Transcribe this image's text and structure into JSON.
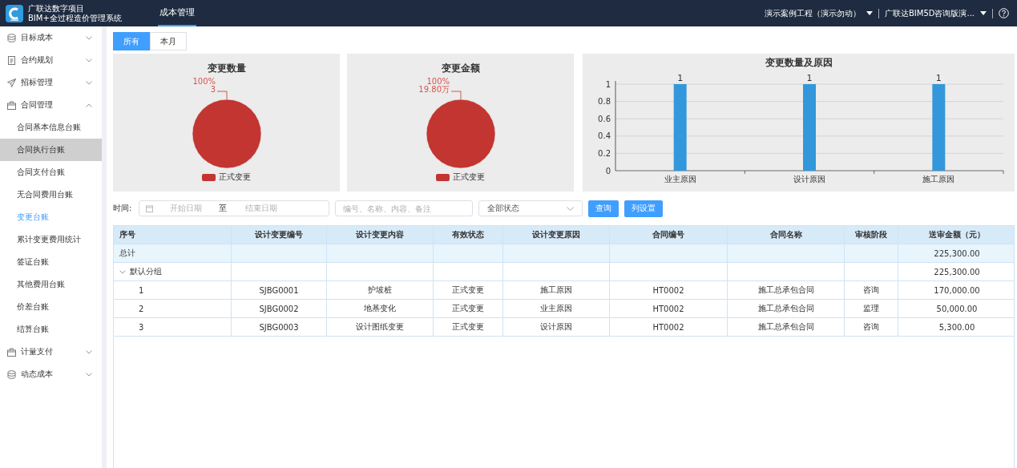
{
  "header": {
    "app_name": "广联达数字项目",
    "app_subtitle": "BIM+全过程造价管理系统",
    "nav_tabs": [
      {
        "label": "成本管理",
        "selected": true
      }
    ],
    "project_selector": "演示案例工程（演示勿动）",
    "org_selector": "广联达BIM5D咨询版演..."
  },
  "sidebar": {
    "items": [
      {
        "label": "目标成本",
        "kind": "database",
        "expanded": false
      },
      {
        "label": "合约规划",
        "kind": "document",
        "expanded": false
      },
      {
        "label": "招标管理",
        "kind": "send",
        "expanded": false
      },
      {
        "label": "合同管理",
        "kind": "box",
        "expanded": true,
        "children": [
          {
            "label": "合同基本信息台账",
            "selected": false,
            "hovered": false
          },
          {
            "label": "合同执行台账",
            "selected": false,
            "hovered": true
          },
          {
            "label": "合同支付台账",
            "selected": false,
            "hovered": false
          },
          {
            "label": "无合同费用台账",
            "selected": false,
            "hovered": false
          },
          {
            "label": "变更台账",
            "selected": true,
            "hovered": false
          },
          {
            "label": "累计变更费用统计",
            "selected": false,
            "hovered": false
          },
          {
            "label": "签证台账",
            "selected": false,
            "hovered": false
          },
          {
            "label": "其他费用台账",
            "selected": false,
            "hovered": false
          },
          {
            "label": "价差台账",
            "selected": false,
            "hovered": false
          },
          {
            "label": "结算台账",
            "selected": false,
            "hovered": false
          }
        ]
      },
      {
        "label": "计量支付",
        "kind": "box",
        "expanded": false
      },
      {
        "label": "动态成本",
        "kind": "database",
        "expanded": false
      }
    ]
  },
  "period_tabs": [
    {
      "label": "所有",
      "selected": true
    },
    {
      "label": "本月",
      "selected": false
    }
  ],
  "charts": [
    {
      "chart_data": {
        "type": "pie",
        "title": "变更数量",
        "categories": [
          "正式变更"
        ],
        "series": [
          {
            "color": "#c23531",
            "values": [
              100
            ]
          }
        ],
        "value_labels": [
          [
            "100%",
            "3"
          ]
        ]
      }
    },
    {
      "chart_data": {
        "type": "pie",
        "title": "变更金额",
        "categories": [
          "正式变更"
        ],
        "series": [
          {
            "color": "#c23531",
            "values": [
              100
            ]
          }
        ],
        "value_labels": [
          [
            "100%",
            "19.80万"
          ]
        ]
      }
    },
    {
      "chart_data": {
        "type": "bar",
        "title": "变更数量及原因",
        "categories": [
          "业主原因",
          "设计原因",
          "施工原因"
        ],
        "series": [
          {
            "color": "#3398db",
            "values": [
              1,
              1,
              1
            ]
          }
        ],
        "ylim": [
          0,
          1
        ],
        "grid": true,
        "yticks": [
          {
            "value": 0,
            "label": "0"
          },
          {
            "value": 0.2,
            "label": "0.2"
          },
          {
            "value": 0.4,
            "label": "0.4"
          },
          {
            "value": 0.6,
            "label": "0.6"
          },
          {
            "value": 0.8,
            "label": "0.8"
          },
          {
            "value": 1,
            "label": "1"
          }
        ],
        "data_labels": true
      }
    }
  ],
  "filters": {
    "time_label": "时间:",
    "start_placeholder": "开始日期",
    "range_separator": "至",
    "end_placeholder": "结束日期",
    "search_placeholder": "编号、名称、内容、备注",
    "status_value": "全部状态",
    "buttons": [
      "查询",
      "列设置"
    ]
  },
  "table": {
    "columns": [
      "序号",
      "设计变更编号",
      "设计变更内容",
      "有效状态",
      "设计变更原因",
      "合同编号",
      "合同名称",
      "审核阶段",
      "送审金额（元）"
    ],
    "total_row": {
      "label": "总计",
      "amount": "225,300.00"
    },
    "groups": [
      {
        "label": "默认分组",
        "expanded": true,
        "amount": "225,300.00",
        "rows": [
          [
            "1",
            "SJBG0001",
            "护坡桩",
            "正式变更",
            "施工原因",
            "HT0002",
            "施工总承包合同",
            "咨询",
            "170,000.00"
          ],
          [
            "2",
            "SJBG0002",
            "地基变化",
            "正式变更",
            "业主原因",
            "HT0002",
            "施工总承包合同",
            "监理",
            "50,000.00"
          ],
          [
            "3",
            "SJBG0003",
            "设计图纸变更",
            "正式变更",
            "设计原因",
            "HT0002",
            "施工总承包合同",
            "咨询",
            "5,300.00"
          ]
        ]
      }
    ]
  }
}
